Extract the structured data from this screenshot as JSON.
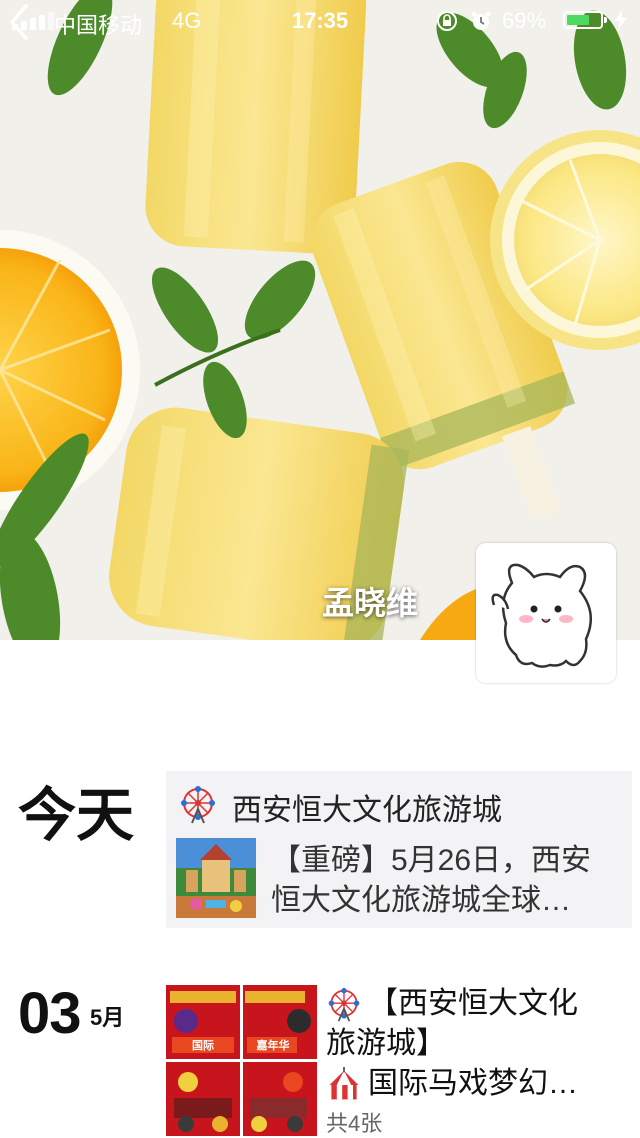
{
  "status_bar": {
    "carrier": "中国移动",
    "network": "4G",
    "time": "17:35",
    "battery_percent": "69%",
    "battery_level": 0.69,
    "lock_icon": "orientation-lock-icon",
    "alarm_icon": "alarm-icon",
    "charge_icon": "charging-bolt-icon"
  },
  "header": {
    "back_icon": "chevron-left-icon",
    "cover_image": "lemon-popsicles-with-mint-and-orange-slices",
    "username": "孟晓维",
    "avatar": "white-cartoon-cat-waving"
  },
  "feed": {
    "entries": [
      {
        "date_label": "今天",
        "card": {
          "icon": "ferris-wheel-icon",
          "title": "西安恒大文化旅游城",
          "thumb": "theme-park-castle-photo",
          "desc_line1": "【重磅】5月26日，西安",
          "desc_line2": "恒大文化旅游城全球…"
        }
      },
      {
        "date_day": "03",
        "date_month": "5月",
        "thumbs": [
          "circus-poster-1",
          "circus-poster-2",
          "circus-poster-3",
          "circus-poster-4"
        ],
        "post_line1": "【西安恒大文化",
        "post_line2": "旅游城】",
        "post_line3": "国际马戏梦幻…",
        "post_icon1": "ferris-wheel-icon",
        "post_icon2": "circus-tent-icon",
        "photo_count": "共4张"
      }
    ]
  },
  "colors": {
    "battery_green": "#4cd964",
    "card_background": "#f3f3f5",
    "poster_red": "#c8141c"
  }
}
